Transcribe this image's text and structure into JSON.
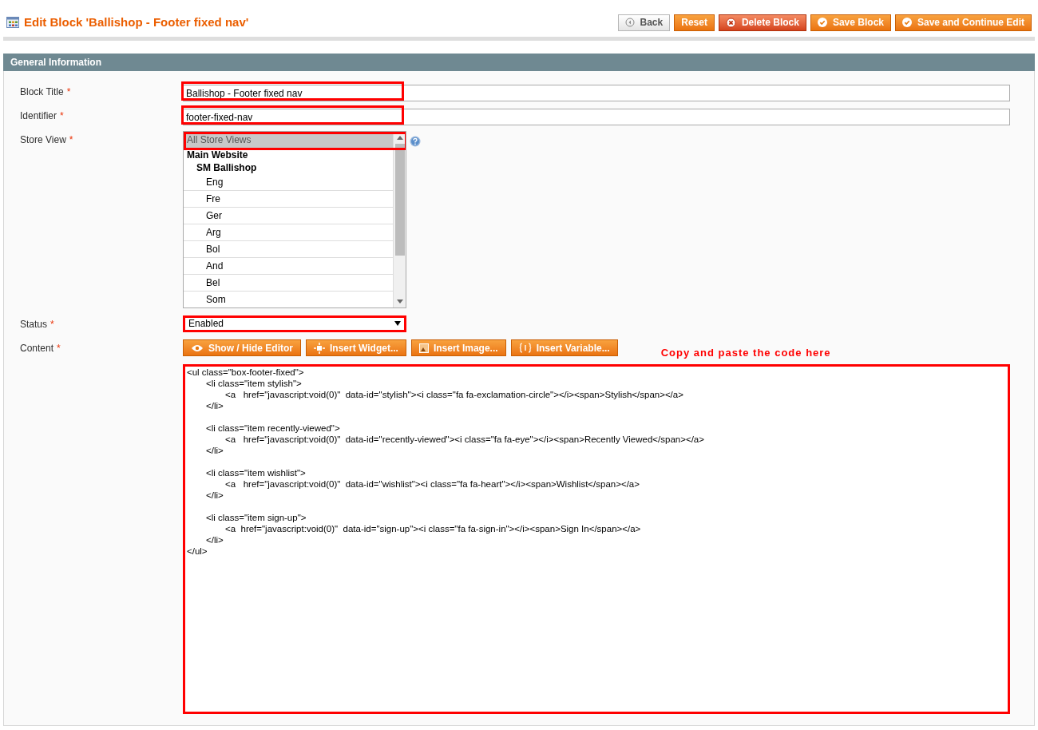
{
  "page": {
    "title": "Edit Block 'Ballishop - Footer fixed nav'"
  },
  "actions": [
    {
      "label": "Back",
      "kind": "back"
    },
    {
      "label": "Reset",
      "kind": "plain"
    },
    {
      "label": "Delete Block",
      "kind": "delete"
    },
    {
      "label": "Save Block",
      "kind": "save"
    },
    {
      "label": "Save and Continue Edit",
      "kind": "save"
    }
  ],
  "section": {
    "title": "General Information"
  },
  "fields": [
    {
      "label": "Block Title",
      "required": "*",
      "kind": "text",
      "value": "Ballishop - Footer fixed nav",
      "highlighted": true
    },
    {
      "label": "Identifier",
      "required": "*",
      "kind": "text",
      "value": "footer-fixed-nav",
      "highlighted": true
    },
    {
      "label": "Store View",
      "required": "*",
      "kind": "multiselect",
      "highlighted": true,
      "options": [
        {
          "label": "All Store Views",
          "kind": "option",
          "selected": true
        },
        {
          "label": "Main Website",
          "kind": "group",
          "selected": false
        },
        {
          "label": "SM Ballishop",
          "kind": "subgroup",
          "selected": false
        },
        {
          "label": "Eng",
          "kind": "view",
          "selected": false
        },
        {
          "label": "Fre",
          "kind": "view",
          "selected": false
        },
        {
          "label": "Ger",
          "kind": "view",
          "selected": false
        },
        {
          "label": "Arg",
          "kind": "view",
          "selected": false
        },
        {
          "label": "Bol",
          "kind": "view",
          "selected": false
        },
        {
          "label": "And",
          "kind": "view",
          "selected": false
        },
        {
          "label": "Bel",
          "kind": "view",
          "selected": false
        },
        {
          "label": "Som",
          "kind": "view",
          "selected": false
        }
      ]
    },
    {
      "label": "Status",
      "required": "*",
      "kind": "select",
      "value": "Enabled",
      "highlighted": true
    },
    {
      "label": "Content",
      "required": "*",
      "kind": "editor",
      "highlighted": true,
      "tools": [
        {
          "label": "Show / Hide Editor",
          "kind": "eye"
        },
        {
          "label": "Insert Widget...",
          "kind": "widget"
        },
        {
          "label": "Insert Image...",
          "kind": "image"
        },
        {
          "label": "Insert Variable...",
          "kind": "variable"
        }
      ],
      "note": "Copy and paste the code here",
      "value": "<ul class=\"box-footer-fixed\">\n\t<li class=\"item stylish\">\n\t\t<a   href=\"javascript:void(0)\"  data-id=\"stylish\"><i class=\"fa fa-exclamation-circle\"></i><span>Stylish</span></a>\n\t</li>\n\n\t<li class=\"item recently-viewed\">\n\t\t<a   href=\"javascript:void(0)\"  data-id=\"recently-viewed\"><i class=\"fa fa-eye\"></i><span>Recently Viewed</span></a>\n\t</li>\n\n\t<li class=\"item wishlist\">\n\t\t<a   href=\"javascript:void(0)\"  data-id=\"wishlist\"><i class=\"fa fa-heart\"></i><span>Wishlist</span></a>\n\t</li>\n\n\t<li class=\"item sign-up\">\n\t\t<a  href=\"javascript:void(0)\"  data-id=\"sign-up\"><i class=\"fa fa-sign-in\"></i><span>Sign In</span></a>\n\t</li>\n</ul>"
    }
  ]
}
